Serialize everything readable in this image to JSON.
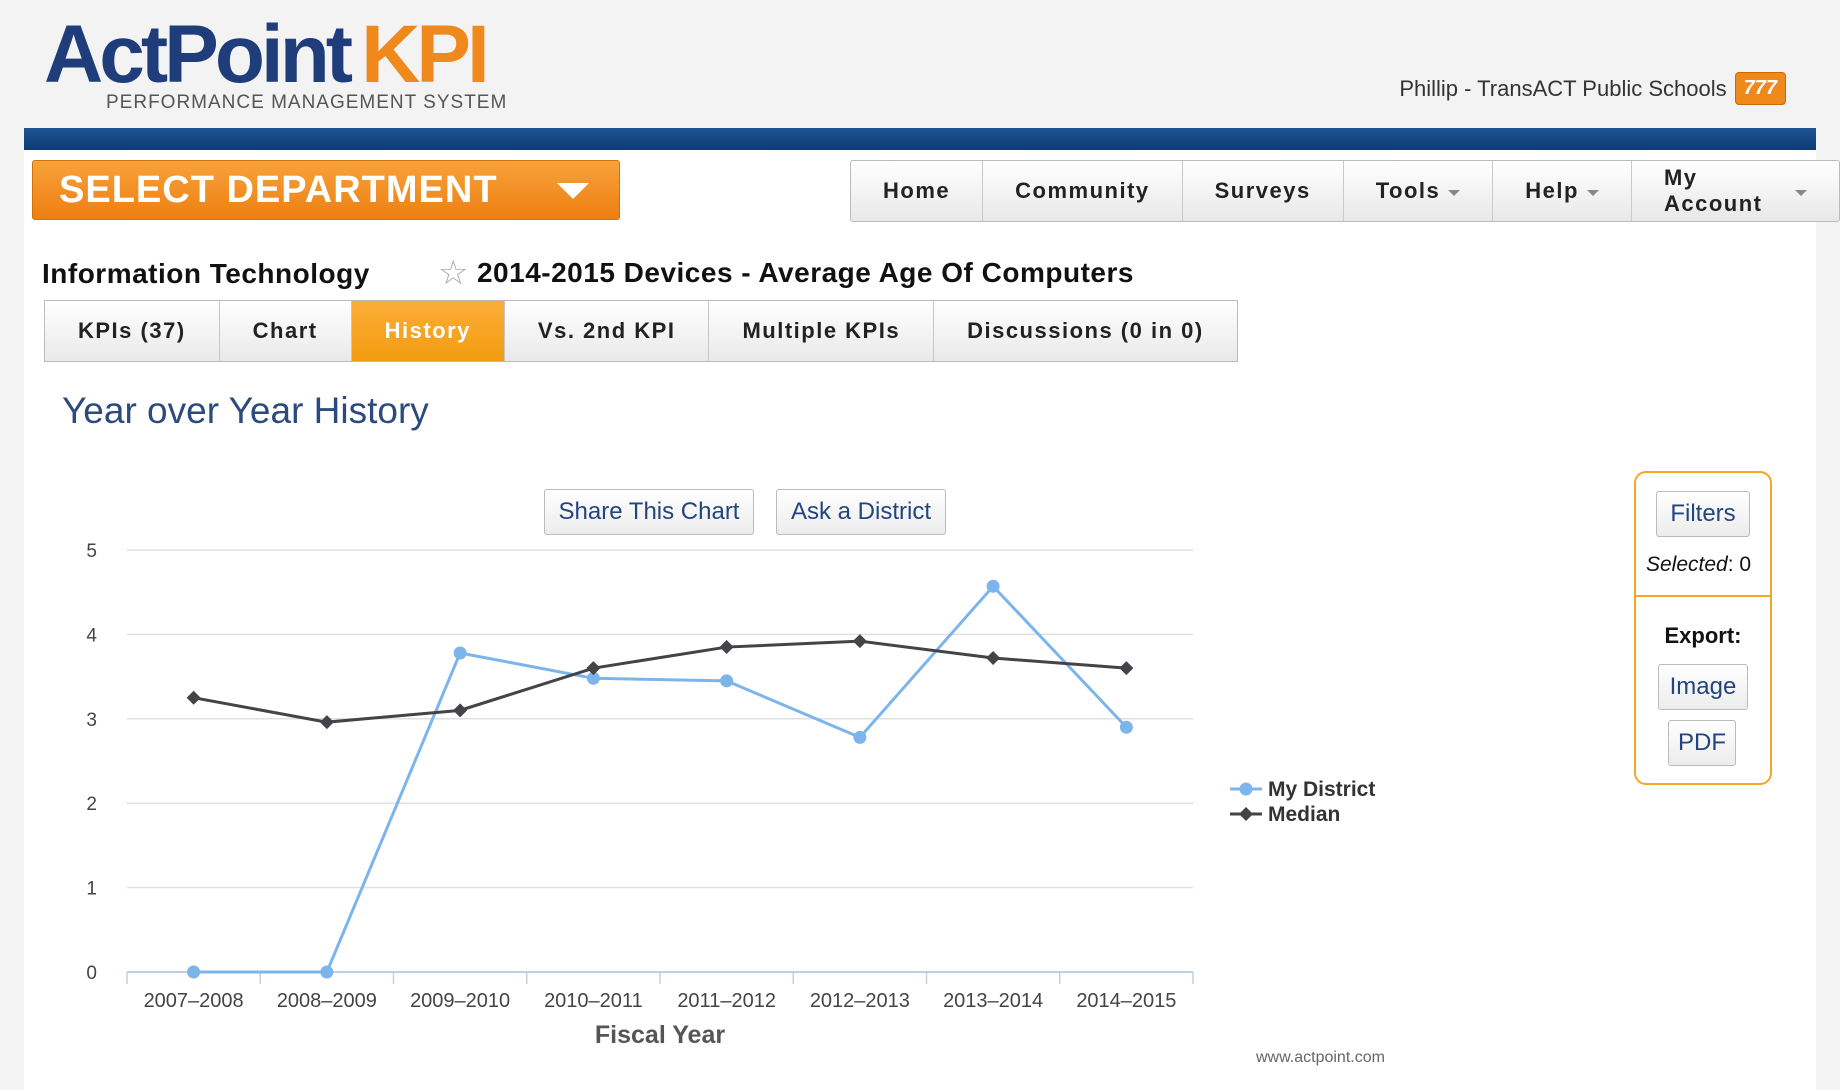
{
  "brand": {
    "name_part1": "ActPoint",
    "name_part2": "KPI",
    "tagline": "PERFORMANCE MANAGEMENT SYSTEM"
  },
  "user": {
    "label": "Phillip - TransACT Public Schools",
    "badge": "777"
  },
  "department_button": {
    "label": "SELECT DEPARTMENT"
  },
  "nav": {
    "items": [
      {
        "label": "Home",
        "dropdown": false
      },
      {
        "label": "Community",
        "dropdown": false
      },
      {
        "label": "Surveys",
        "dropdown": false
      },
      {
        "label": "Tools",
        "dropdown": true
      },
      {
        "label": "Help",
        "dropdown": true
      },
      {
        "label": "My Account",
        "dropdown": true
      }
    ]
  },
  "breadcrumb": {
    "department": "Information Technology",
    "kpi_title": "2014-2015 Devices - Average Age Of Computers"
  },
  "tabs": [
    {
      "label": "KPIs (37)",
      "active": false
    },
    {
      "label": "Chart",
      "active": false
    },
    {
      "label": "History",
      "active": true
    },
    {
      "label": "Vs. 2nd KPI",
      "active": false
    },
    {
      "label": "Multiple KPIs",
      "active": false
    },
    {
      "label": "Discussions (0 in 0)",
      "active": false
    }
  ],
  "section_title": "Year over Year History",
  "chart_buttons": {
    "share": "Share This Chart",
    "ask": "Ask a District"
  },
  "side_panel": {
    "filters_label": "Filters",
    "selected_label": "Selected",
    "selected_value": "0",
    "export_label": "Export:",
    "image_label": "Image",
    "pdf_label": "PDF"
  },
  "footer_url": "www.actpoint.com",
  "colors": {
    "accent_orange": "#f39c12",
    "nav_blue": "#1c5494",
    "series_district": "#7cb5ec",
    "series_median": "#434348"
  },
  "chart_data": {
    "type": "line",
    "title": "",
    "xlabel": "Fiscal Year",
    "ylabel": "",
    "ylim": [
      0,
      5
    ],
    "yticks": [
      0,
      1,
      2,
      3,
      4,
      5
    ],
    "categories": [
      "2007–2008",
      "2008–2009",
      "2009–2010",
      "2010–2011",
      "2011–2012",
      "2012–2013",
      "2013–2014",
      "2014–2015"
    ],
    "series": [
      {
        "name": "My District",
        "color": "#7cb5ec",
        "marker": "circle",
        "values": [
          0,
          0,
          3.78,
          3.48,
          3.45,
          2.78,
          4.57,
          2.9
        ]
      },
      {
        "name": "Median",
        "color": "#434348",
        "marker": "diamond",
        "values": [
          3.25,
          2.96,
          3.1,
          3.6,
          3.85,
          3.92,
          3.72,
          3.6
        ]
      }
    ],
    "legend_position": "right",
    "grid": true
  }
}
